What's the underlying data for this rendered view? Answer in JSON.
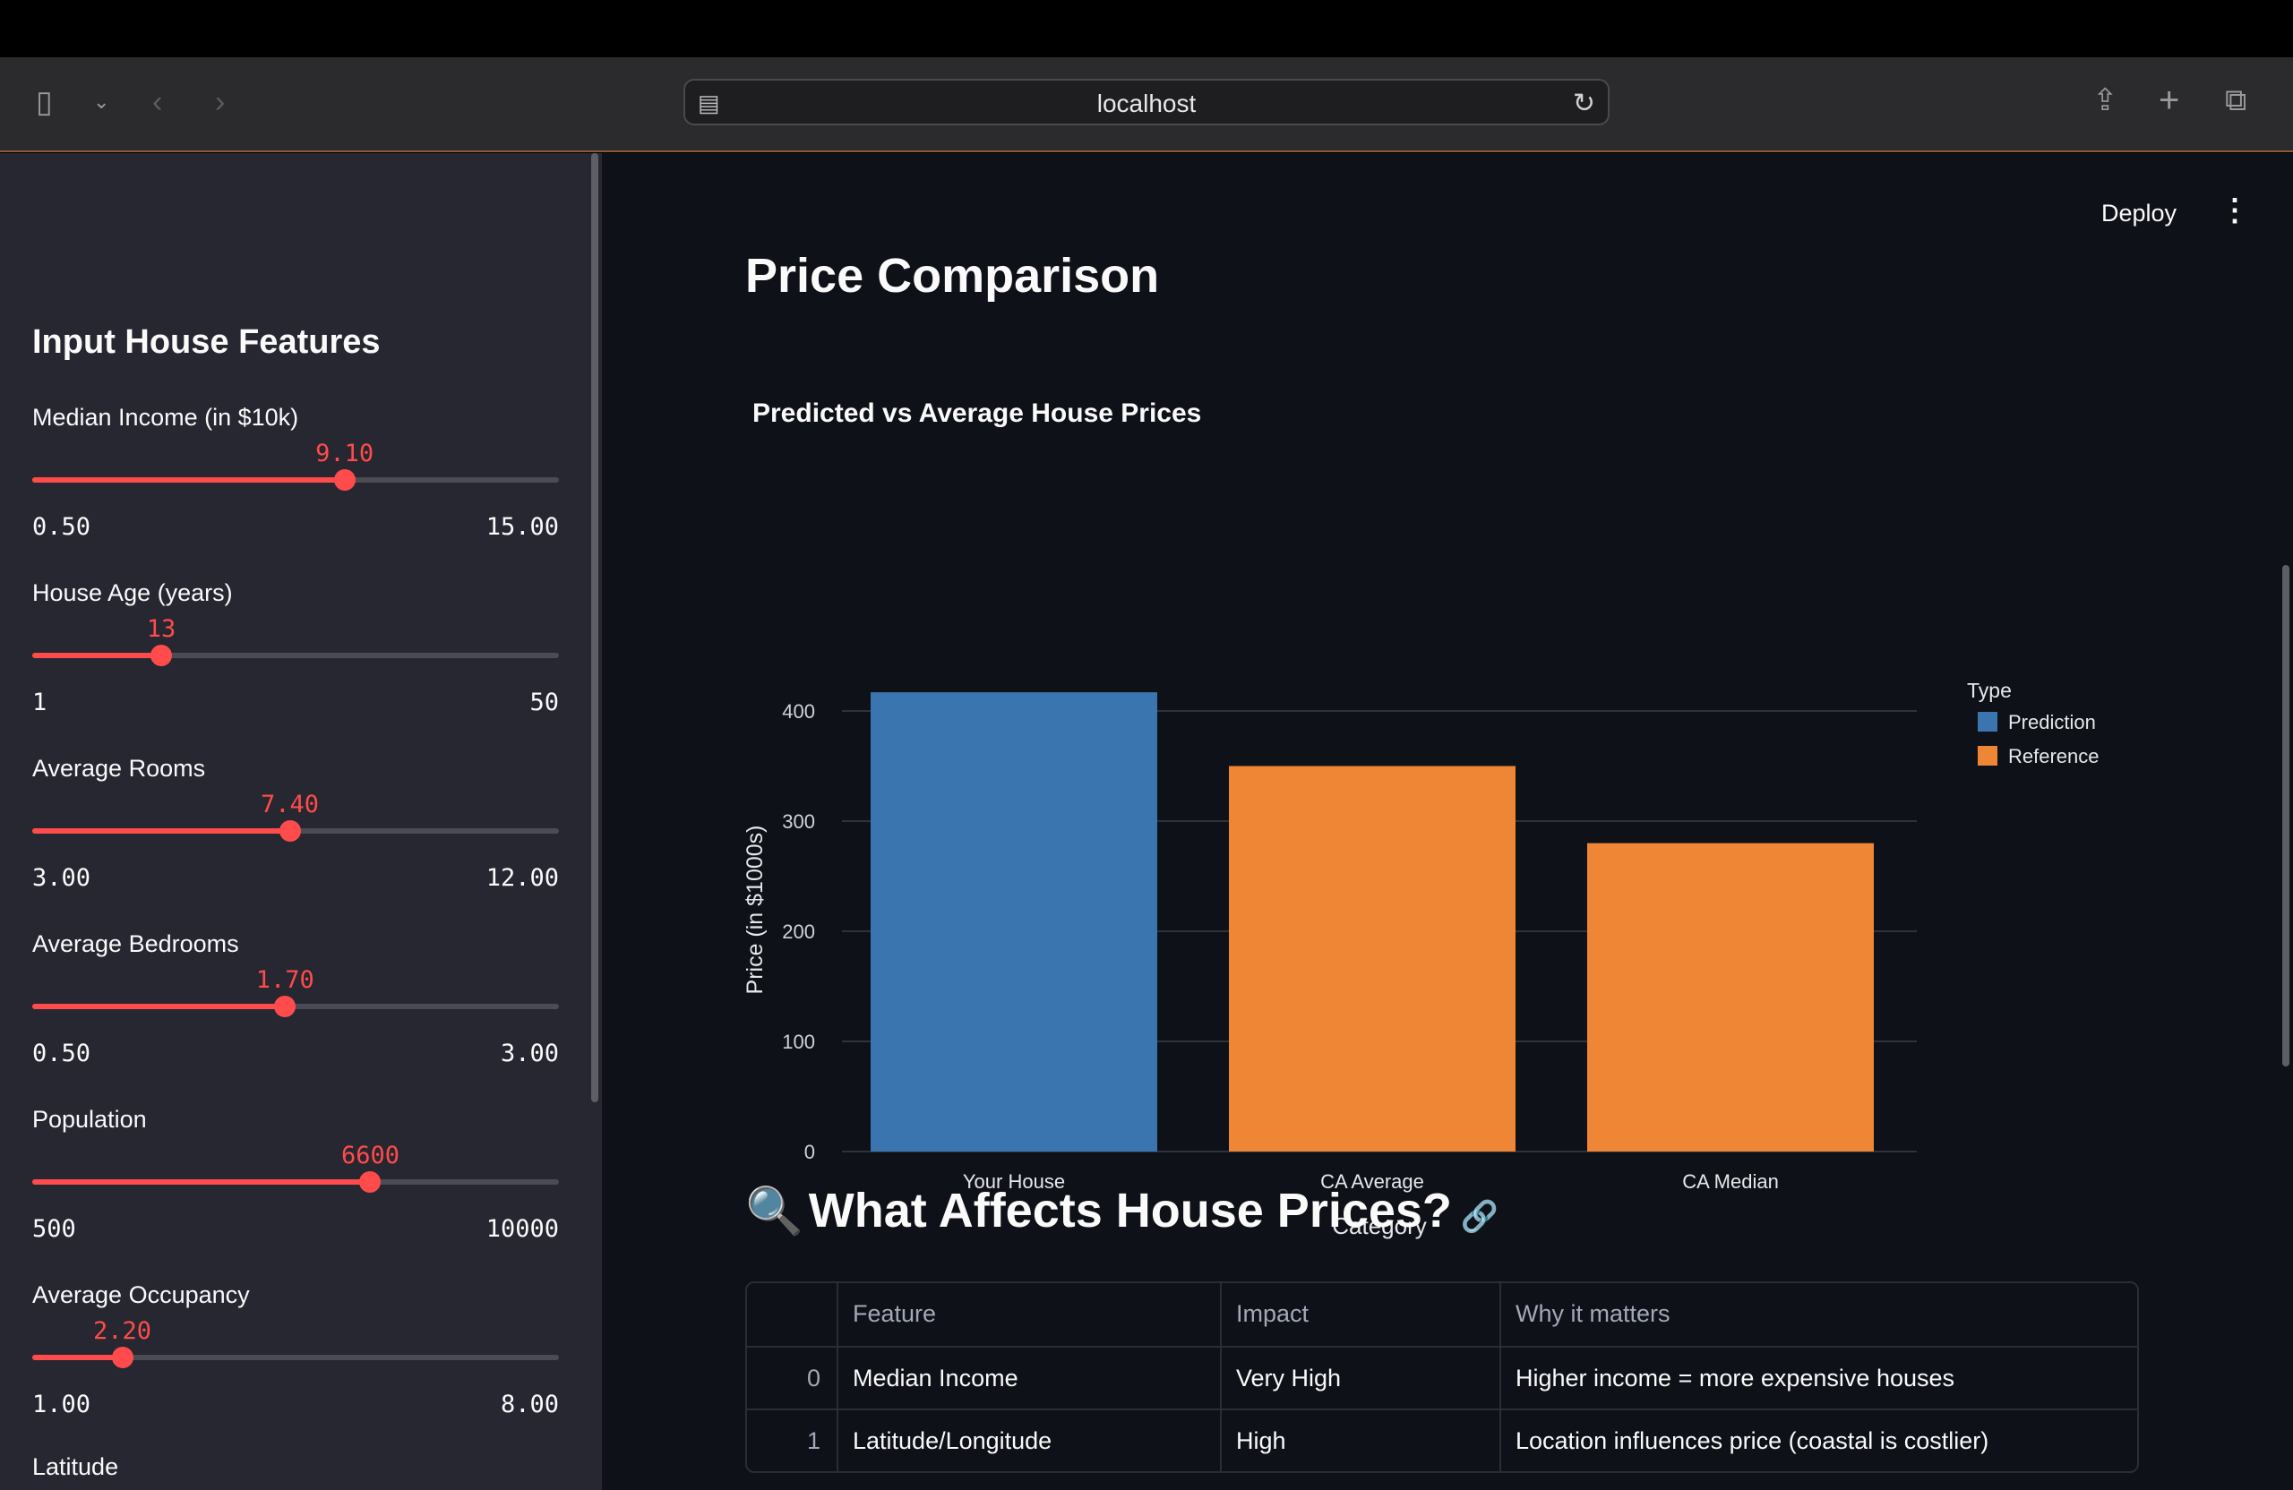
{
  "browser": {
    "url": "localhost"
  },
  "header": {
    "deploy_label": "Deploy",
    "menu_icon": "⋮"
  },
  "sidebar": {
    "title": "Input House Features",
    "sliders": [
      {
        "label": "Median Income (in $10k)",
        "value": "9.10",
        "min": "0.50",
        "max": "15.00",
        "fraction": 0.593
      },
      {
        "label": "House Age (years)",
        "value": "13",
        "min": "1",
        "max": "50",
        "fraction": 0.245
      },
      {
        "label": "Average Rooms",
        "value": "7.40",
        "min": "3.00",
        "max": "12.00",
        "fraction": 0.489
      },
      {
        "label": "Average Bedrooms",
        "value": "1.70",
        "min": "0.50",
        "max": "3.00",
        "fraction": 0.48
      },
      {
        "label": "Population",
        "value": "6600",
        "min": "500",
        "max": "10000",
        "fraction": 0.642
      },
      {
        "label": "Average Occupancy",
        "value": "2.20",
        "min": "1.00",
        "max": "8.00",
        "fraction": 0.171
      }
    ],
    "next_label": "Latitude"
  },
  "main": {
    "page_title": "Price Comparison",
    "section_title": "What Affects House Prices?",
    "section_icon": "🔍",
    "link_icon": "🔗"
  },
  "chart_data": {
    "type": "bar",
    "title": "Predicted vs Average House Prices",
    "xlabel": "Category",
    "ylabel": "Price (in $1000s)",
    "categories": [
      "Your House",
      "CA Average",
      "CA Median"
    ],
    "values": [
      417,
      350,
      280
    ],
    "series_type": [
      "Prediction",
      "Reference",
      "Reference"
    ],
    "ylim": [
      0,
      435
    ],
    "yticks": [
      0,
      100,
      200,
      300,
      400
    ],
    "grid": true,
    "legend": {
      "title": "Type",
      "position": "top-right",
      "entries": [
        {
          "name": "Prediction",
          "color": "#3b75af"
        },
        {
          "name": "Reference",
          "color": "#ef8636"
        }
      ]
    }
  },
  "table": {
    "headers": [
      "",
      "Feature",
      "Impact",
      "Why it matters"
    ],
    "rows": [
      [
        "0",
        "Median Income",
        "Very High",
        "Higher income = more expensive houses"
      ],
      [
        "1",
        "Latitude/Longitude",
        "High",
        "Location influences price (coastal is costlier)"
      ]
    ]
  },
  "colors": {
    "accent": "#ff4b4b",
    "background": "#0e1117",
    "sidebar": "#262730"
  }
}
